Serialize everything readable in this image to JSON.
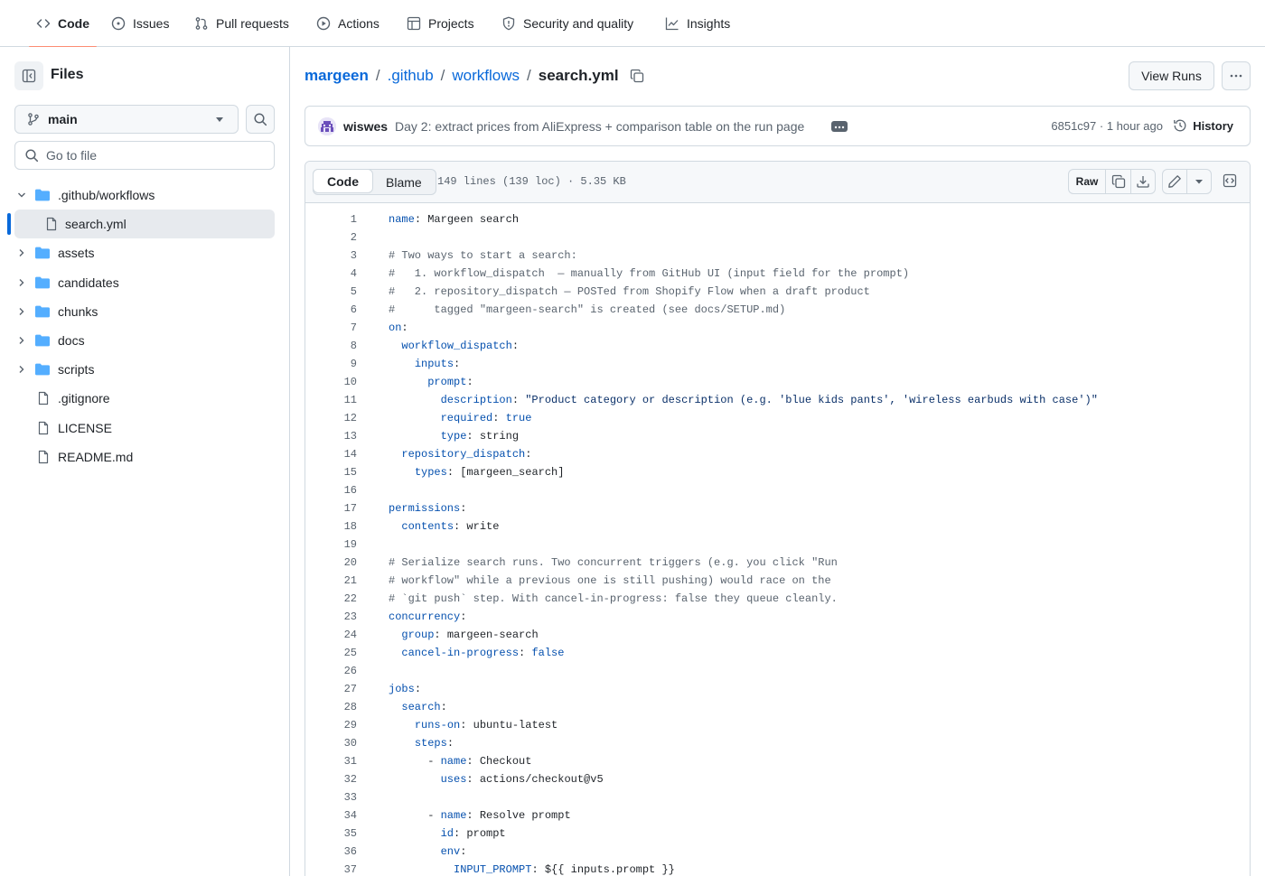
{
  "nav": {
    "tabs": [
      {
        "label": "Code",
        "icon": "code-icon",
        "active": true
      },
      {
        "label": "Issues",
        "icon": "issue-icon"
      },
      {
        "label": "Pull requests",
        "icon": "pull-request-icon"
      },
      {
        "label": "Actions",
        "icon": "play-icon"
      },
      {
        "label": "Projects",
        "icon": "table-icon"
      },
      {
        "label": "Security and quality",
        "icon": "shield-icon"
      },
      {
        "label": "Insights",
        "icon": "graph-icon"
      }
    ]
  },
  "sidebar": {
    "title": "Files",
    "branch": "main",
    "goto_placeholder": "Go to file",
    "tree": [
      {
        "label": ".github/workflows",
        "type": "folder",
        "expanded": true
      },
      {
        "label": "search.yml",
        "type": "file",
        "selected": true
      },
      {
        "label": "assets",
        "type": "folder"
      },
      {
        "label": "candidates",
        "type": "folder"
      },
      {
        "label": "chunks",
        "type": "folder"
      },
      {
        "label": "docs",
        "type": "folder"
      },
      {
        "label": "scripts",
        "type": "folder"
      },
      {
        "label": ".gitignore",
        "type": "file"
      },
      {
        "label": "LICENSE",
        "type": "file"
      },
      {
        "label": "README.md",
        "type": "file"
      }
    ]
  },
  "breadcrumb": {
    "parts": [
      "margeen",
      ".github",
      "workflows"
    ],
    "current": "search.yml",
    "separator": "/"
  },
  "header": {
    "view_runs": "View Runs"
  },
  "commit": {
    "author": "wiswes",
    "message": "Day 2: extract prices from AliExpress + comparison table on the run page",
    "sha_time": "6851c97 · 1 hour ago",
    "history": "History"
  },
  "file": {
    "tabs": [
      "Code",
      "Blame"
    ],
    "meta": "149 lines (139 loc) · 5.35 KB",
    "raw": "Raw",
    "lines": [
      "name: Margeen search",
      "",
      "# Two ways to start a search:",
      "#   1. workflow_dispatch  — manually from GitHub UI (input field for the prompt)",
      "#   2. repository_dispatch — POSTed from Shopify Flow when a draft product",
      "#      tagged \"margeen-search\" is created (see docs/SETUP.md)",
      "on:",
      "  workflow_dispatch:",
      "    inputs:",
      "      prompt:",
      "        description: \"Product category or description (e.g. 'blue kids pants', 'wireless earbuds with case')\"",
      "        required: true",
      "        type: string",
      "  repository_dispatch:",
      "    types: [margeen_search]",
      "",
      "permissions:",
      "  contents: write",
      "",
      "# Serialize search runs. Two concurrent triggers (e.g. you click \"Run",
      "# workflow\" while a previous one is still pushing) would race on the",
      "# `git push` step. With cancel-in-progress: false they queue cleanly.",
      "concurrency:",
      "  group: margeen-search",
      "  cancel-in-progress: false",
      "",
      "jobs:",
      "  search:",
      "    runs-on: ubuntu-latest",
      "    steps:",
      "      - name: Checkout",
      "        uses: actions/checkout@v5",
      "",
      "      - name: Resolve prompt",
      "        id: prompt",
      "        env:",
      "          INPUT_PROMPT: ${{ inputs.prompt }}"
    ]
  },
  "colors": {
    "accent": "#0969da",
    "tab_underline": "#fd8c73",
    "folder": "#54aeff",
    "key": "#0550ae",
    "comment": "#59636e",
    "string": "#0a3069"
  }
}
